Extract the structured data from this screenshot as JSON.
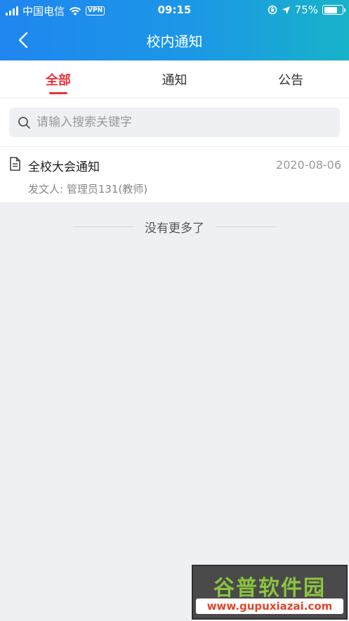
{
  "status_bar": {
    "carrier": "中国电信",
    "vpn": "VPN",
    "time": "09:15",
    "battery_percent": "75%",
    "battery_level": 0.75
  },
  "navbar": {
    "title": "校内通知",
    "back_icon": "chevron-left-icon"
  },
  "tabs": [
    {
      "label": "全部",
      "active": true
    },
    {
      "label": "通知",
      "active": false
    },
    {
      "label": "公告",
      "active": false
    }
  ],
  "search": {
    "placeholder": "请输入搜索关键字",
    "value": "",
    "icon": "search-icon"
  },
  "notices": [
    {
      "title": "全校大会通知",
      "date": "2020-08-06",
      "sender": "发文人: 管理员131(教师)",
      "icon": "document-icon"
    }
  ],
  "footer": {
    "no_more": "没有更多了"
  },
  "watermark": {
    "title": "谷普软件园",
    "url": "www.gupuxiazai.com"
  },
  "colors": {
    "accent": "#e8333a",
    "header_start": "#1f86f0",
    "header_end": "#17b3c9",
    "background": "#eff0f4"
  }
}
